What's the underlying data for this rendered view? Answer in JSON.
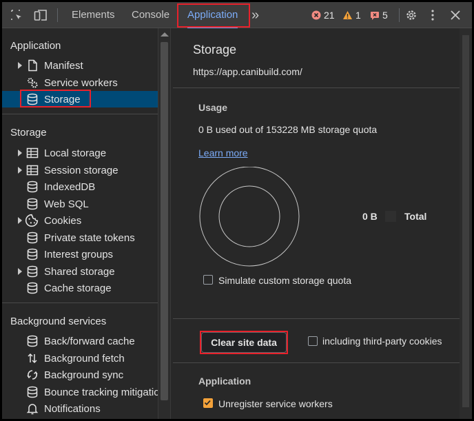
{
  "toolbar": {
    "tabs": [
      "Elements",
      "Console",
      "Application"
    ],
    "more_label": "»",
    "errors": "21",
    "warnings": "1",
    "issues": "5"
  },
  "sidebar": {
    "application_title": "Application",
    "application_items": [
      {
        "label": "Manifest",
        "icon": "document-icon"
      },
      {
        "label": "Service workers",
        "icon": "gears-icon"
      },
      {
        "label": "Storage",
        "icon": "database-icon"
      }
    ],
    "storage_title": "Storage",
    "storage_items": [
      {
        "label": "Local storage",
        "icon": "table-icon"
      },
      {
        "label": "Session storage",
        "icon": "table-icon"
      },
      {
        "label": "IndexedDB",
        "icon": "database-icon"
      },
      {
        "label": "Web SQL",
        "icon": "database-icon"
      },
      {
        "label": "Cookies",
        "icon": "cookie-icon"
      },
      {
        "label": "Private state tokens",
        "icon": "database-icon"
      },
      {
        "label": "Interest groups",
        "icon": "database-icon"
      },
      {
        "label": "Shared storage",
        "icon": "database-icon"
      },
      {
        "label": "Cache storage",
        "icon": "database-icon"
      }
    ],
    "background_title": "Background services",
    "background_items": [
      {
        "label": "Back/forward cache",
        "icon": "database-icon"
      },
      {
        "label": "Background fetch",
        "icon": "fetch-arrows-icon"
      },
      {
        "label": "Background sync",
        "icon": "sync-icon"
      },
      {
        "label": "Bounce tracking mitigations",
        "icon": "database-icon"
      },
      {
        "label": "Notifications",
        "icon": "bell-icon"
      }
    ]
  },
  "main": {
    "title": "Storage",
    "origin": "https://app.canibuild.com/",
    "usage_heading": "Usage",
    "usage_text": "0 B used out of 153228 MB storage quota",
    "learn_more": "Learn more",
    "legend_value": "0 B",
    "legend_label": "Total",
    "simulate_label": "Simulate custom storage quota",
    "clear_button": "Clear site data",
    "third_party_label": "including third-party cookies",
    "application_heading": "Application",
    "unregister_label": "Unregister service workers"
  },
  "colors": {
    "accent": "#7cacf8",
    "selected_bg": "#004a77",
    "highlight": "#e8212b",
    "checkbox_checked": "#f4a23a"
  }
}
